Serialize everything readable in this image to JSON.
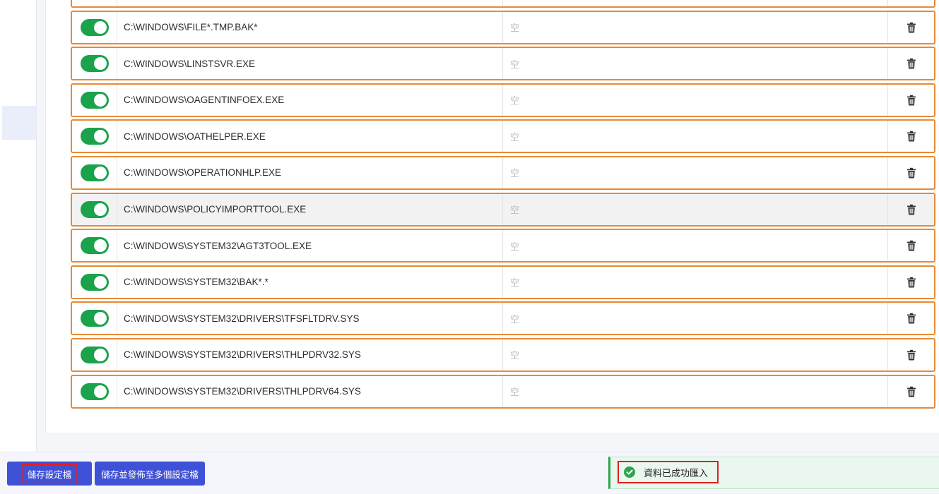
{
  "table": {
    "rows": [
      {
        "path": "",
        "note": "",
        "enabled": true,
        "highlight": false
      },
      {
        "path": "C:\\WINDOWS\\FILE*.TMP.BAK*",
        "note": "空",
        "enabled": true,
        "highlight": false
      },
      {
        "path": "C:\\WINDOWS\\LINSTSVR.EXE",
        "note": "空",
        "enabled": true,
        "highlight": false
      },
      {
        "path": "C:\\WINDOWS\\OAGENTINFOEX.EXE",
        "note": "空",
        "enabled": true,
        "highlight": false
      },
      {
        "path": "C:\\WINDOWS\\OATHELPER.EXE",
        "note": "空",
        "enabled": true,
        "highlight": false
      },
      {
        "path": "C:\\WINDOWS\\OPERATIONHLP.EXE",
        "note": "空",
        "enabled": true,
        "highlight": false
      },
      {
        "path": "C:\\WINDOWS\\POLICYIMPORTTOOL.EXE",
        "note": "空",
        "enabled": true,
        "highlight": true
      },
      {
        "path": "C:\\WINDOWS\\SYSTEM32\\AGT3TOOL.EXE",
        "note": "空",
        "enabled": true,
        "highlight": false
      },
      {
        "path": "C:\\WINDOWS\\SYSTEM32\\BAK*.*",
        "note": "空",
        "enabled": true,
        "highlight": false
      },
      {
        "path": "C:\\WINDOWS\\SYSTEM32\\DRIVERS\\TFSFLTDRV.SYS",
        "note": "空",
        "enabled": true,
        "highlight": false
      },
      {
        "path": "C:\\WINDOWS\\SYSTEM32\\DRIVERS\\THLPDRV32.SYS",
        "note": "空",
        "enabled": true,
        "highlight": false
      },
      {
        "path": "C:\\WINDOWS\\SYSTEM32\\DRIVERS\\THLPDRV64.SYS",
        "note": "空",
        "enabled": true,
        "highlight": false
      }
    ]
  },
  "footer": {
    "save_label": "儲存設定檔",
    "publish_label": "儲存並發佈至多個設定檔"
  },
  "toast": {
    "message": "資料已成功匯入"
  },
  "colors": {
    "accent": "#3f51d6",
    "toggle_on": "#1aa34a",
    "row_border": "#e88a36",
    "success": "#2ea44f",
    "highlight_box": "#e02020"
  },
  "icons": {
    "row_action": "trash-icon",
    "toast": "check-circle-icon"
  }
}
